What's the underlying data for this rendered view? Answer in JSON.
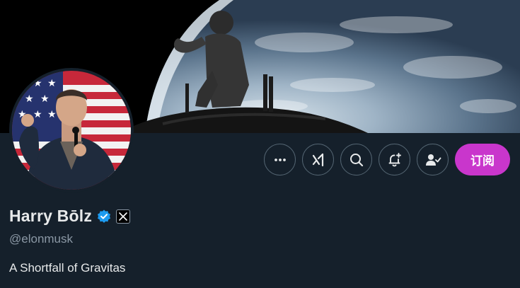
{
  "profile": {
    "display_name": "Harry Bōlz",
    "handle": "@elonmusk",
    "bio": "A Shortfall of Gravitas",
    "verified": true,
    "affiliation_badge": "x-logo-icon"
  },
  "actions": {
    "icons": [
      "more-icon",
      "grok-icon",
      "search-icon",
      "notification-bell-icon",
      "following-icon"
    ],
    "subscribe_label": "订阅"
  },
  "colors": {
    "background": "#15202b",
    "subscribe": "#c936cc",
    "verified": "#1d9bf0",
    "text_secondary": "#8b98a5",
    "border": "#536471"
  }
}
